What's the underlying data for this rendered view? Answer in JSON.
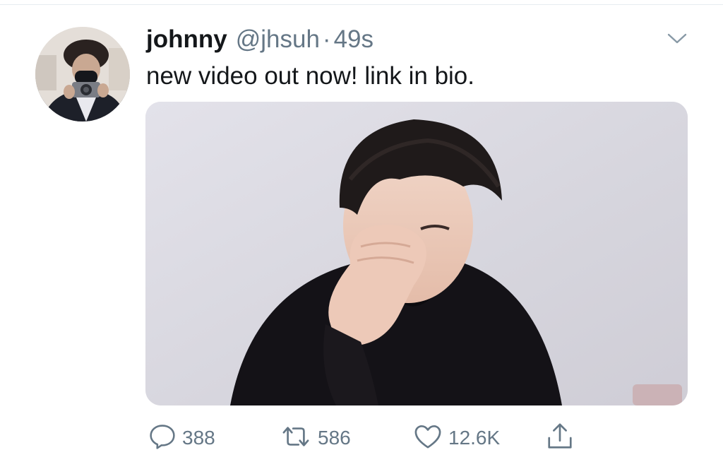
{
  "tweet": {
    "display_name": "johnny",
    "handle": "@jhsuh",
    "separator": "·",
    "time": "49s",
    "text": "new video out now! link in bio."
  },
  "actions": {
    "reply_count": "388",
    "retweet_count": "586",
    "like_count": "12.6K"
  },
  "colors": {
    "text_primary": "#14171a",
    "text_secondary": "#657786",
    "divider": "#e6ecf0"
  },
  "icons": [
    "caret-down-icon",
    "reply-icon",
    "retweet-icon",
    "like-icon",
    "share-icon"
  ]
}
